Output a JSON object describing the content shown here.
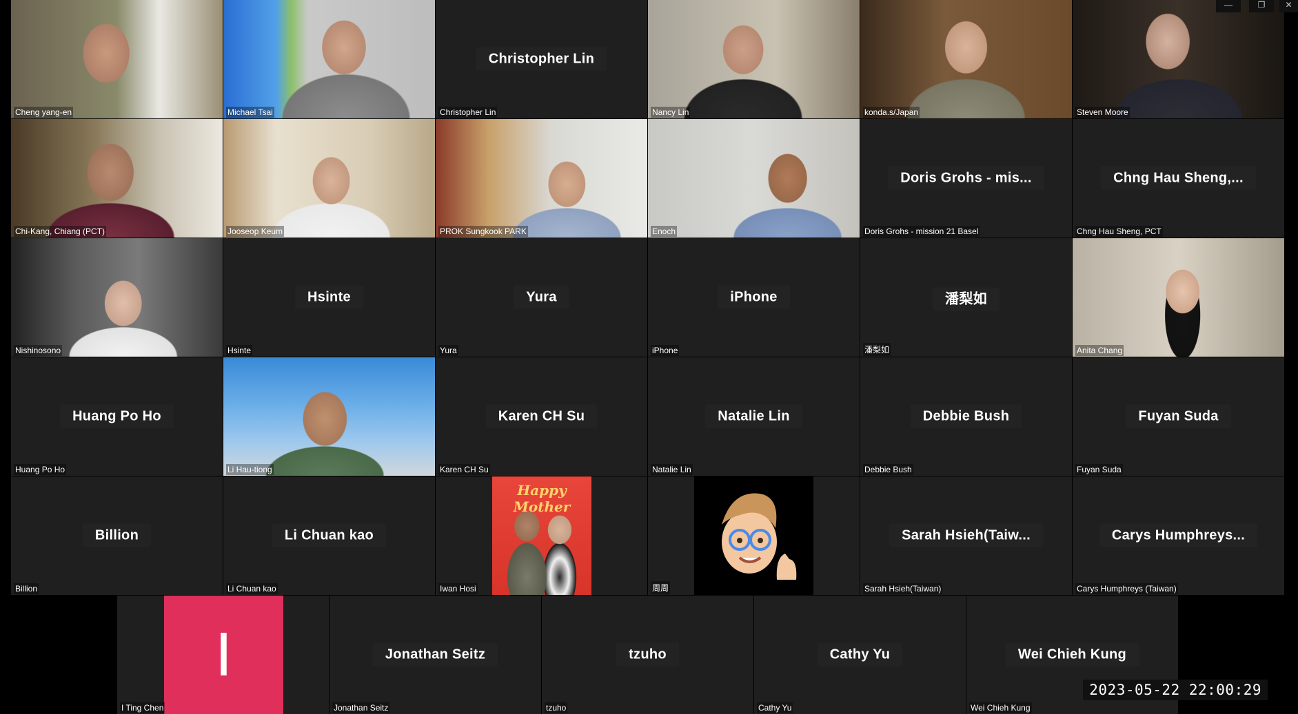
{
  "window_controls": {
    "minimize": "—",
    "restore": "❐",
    "close": "✕"
  },
  "timestamp": "2023-05-22  22:00:29",
  "rows": [
    [
      {
        "label": "Cheng yang-en",
        "video": true
      },
      {
        "label": "Michael Tsai",
        "video": true
      },
      {
        "label": "Christopher Lin",
        "center": "Christopher Lin"
      },
      {
        "label": "Nancy Lin",
        "video": true
      },
      {
        "label": "konda.s/Japan",
        "video": true
      },
      {
        "label": "Steven Moore",
        "video": true
      }
    ],
    [
      {
        "label": "Chi-Kang, Chiang (PCT)",
        "video": true
      },
      {
        "label": "Jooseop Keum",
        "video": true
      },
      {
        "label": "PROK Sungkook PARK",
        "video": true
      },
      {
        "label": "Enoch",
        "video": true
      },
      {
        "label": "Doris Grohs - mission 21 Basel",
        "center": "Doris Grohs - mis..."
      },
      {
        "label": "Chng Hau Sheng, PCT",
        "center": "Chng Hau Sheng,..."
      }
    ],
    [
      {
        "label": "Nishinosono",
        "video": true
      },
      {
        "label": "Hsinte",
        "center": "Hsinte"
      },
      {
        "label": "Yura",
        "center": "Yura"
      },
      {
        "label": "iPhone",
        "center": "iPhone"
      },
      {
        "label": "潘梨如",
        "center": "潘梨如"
      },
      {
        "label": "Anita Chang",
        "video": true
      }
    ],
    [
      {
        "label": "Huang Po Ho",
        "center": "Huang Po Ho"
      },
      {
        "label": "Li Hau-tiong",
        "video": true
      },
      {
        "label": "Karen CH Su",
        "center": "Karen CH Su"
      },
      {
        "label": "Natalie Lin",
        "center": "Natalie Lin"
      },
      {
        "label": "Debbie Bush",
        "center": "Debbie Bush"
      },
      {
        "label": "Fuyan Suda",
        "center": "Fuyan Suda"
      }
    ],
    [
      {
        "label": "Billion",
        "center": "Billion"
      },
      {
        "label": "Li Chuan kao",
        "center": "Li Chuan kao"
      },
      {
        "label": "Iwan Hosi",
        "picture": "happy-mother-photo",
        "picture_text": "Happy Mother"
      },
      {
        "label": "周周",
        "picture": "memoji-avatar"
      },
      {
        "label": "Sarah Hsieh(Taiwan)",
        "center": "Sarah Hsieh(Taiw..."
      },
      {
        "label": "Carys Humphreys (Taiwan)",
        "center": "Carys Humphreys..."
      }
    ],
    [
      {
        "label": "I Ting Chen",
        "picture": "letter-avatar",
        "letter": "I"
      },
      {
        "label": "Jonathan Seitz",
        "center": "Jonathan Seitz"
      },
      {
        "label": "tzuho",
        "center": "tzuho"
      },
      {
        "label": "Cathy Yu",
        "center": "Cathy Yu"
      },
      {
        "label": "Wei Chieh Kung",
        "center": "Wei Chieh Kung"
      }
    ]
  ]
}
